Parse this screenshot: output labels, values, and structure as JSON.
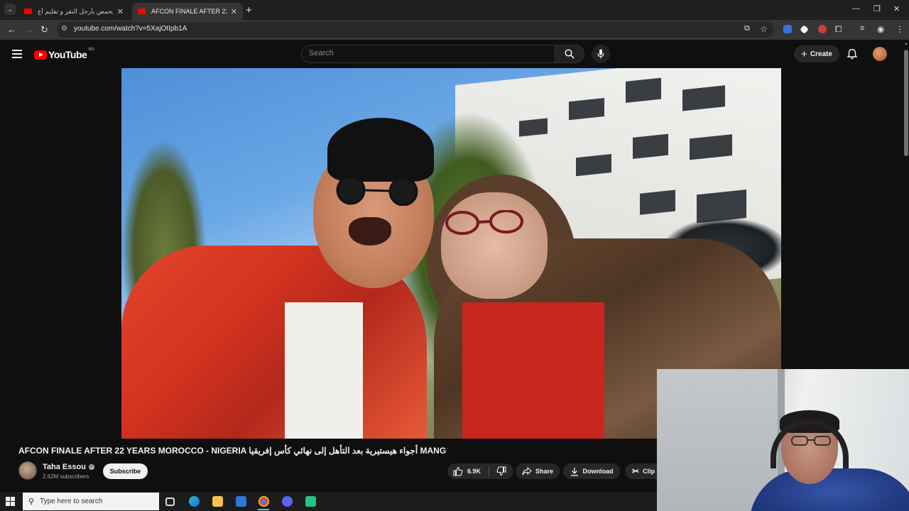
{
  "browser": {
    "tabs": [
      {
        "label": "الحمص بأرجل النقر و تقليم أع..."
      },
      {
        "label": "AFCON FINALE AFTER 22 Y..."
      }
    ],
    "url": "youtube.com/watch?v=5XajOtIpb1A"
  },
  "youtube": {
    "country_code": "MA",
    "logo_text": "YouTube",
    "search_placeholder": "Search",
    "create_label": "Create"
  },
  "video": {
    "title": "AFCON FINALE AFTER 22 YEARS MOROCCO - NIGERIA أجواء هيستيرية بعد التأهل إلى نهائي كأس إفريقيا MANG",
    "channel_name": "Taha Essou",
    "subscribers": "2.62M subscribers",
    "subscribe_label": "Subscribe",
    "likes": "6.9K",
    "share_label": "Share",
    "download_label": "Download",
    "clip_label": "Clip"
  },
  "taskbar": {
    "search_placeholder": "Type here to search"
  },
  "colors": {
    "accent_red": "#ff0000",
    "page_bg": "#0f0f0f",
    "pill_bg": "#272727"
  }
}
